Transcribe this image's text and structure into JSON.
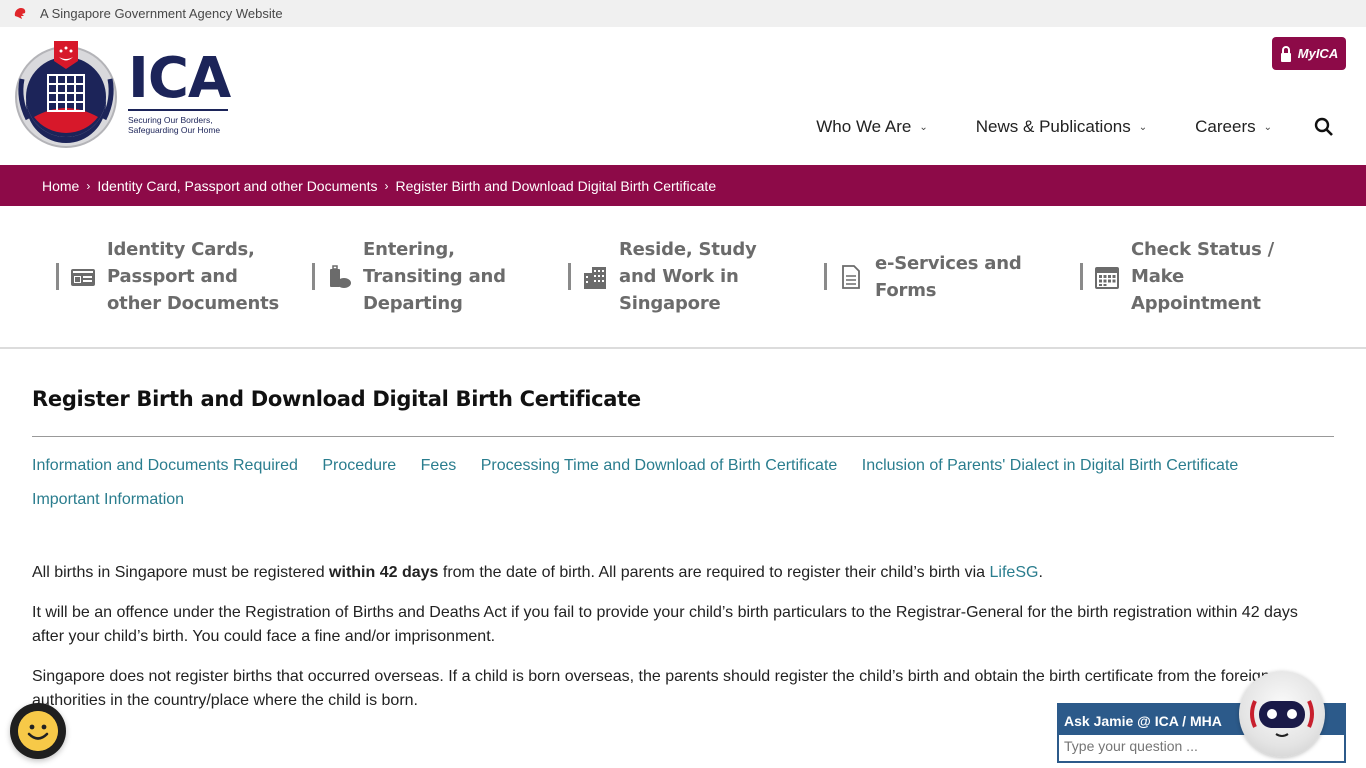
{
  "masthead": {
    "text": "A Singapore Government Agency Website",
    "icon": "lion-head-icon"
  },
  "header": {
    "logo_text": "ICA",
    "tagline_line1": "Securing Our Borders,",
    "tagline_line2": "Safeguarding Our Home",
    "myica_label": "MyICA",
    "nav": [
      {
        "label": "Who We Are"
      },
      {
        "label": "News & Publications"
      },
      {
        "label": "Careers"
      }
    ],
    "search_icon": "search-icon"
  },
  "breadcrumb": [
    {
      "label": "Home"
    },
    {
      "label": "Identity Card, Passport and other Documents"
    },
    {
      "label": "Register Birth and Download Digital Birth Certificate"
    }
  ],
  "quick_links": [
    {
      "label": "Identity Cards, Passport and other Documents",
      "icon": "id-card-icon"
    },
    {
      "label": "Entering, Transiting and Departing",
      "icon": "luggage-icon"
    },
    {
      "label": "Reside, Study and Work in Singapore",
      "icon": "building-icon"
    },
    {
      "label": "e-Services and Forms",
      "icon": "document-icon"
    },
    {
      "label": "Check Status / Make Appointment",
      "icon": "calendar-icon"
    }
  ],
  "page": {
    "title": "Register Birth and Download Digital Birth Certificate",
    "anchors": [
      "Information and Documents Required",
      "Procedure",
      "Fees",
      "Processing Time and Download of Birth Certificate",
      "Inclusion of Parents' Dialect in Digital Birth Certificate",
      "Important Information"
    ],
    "p1_before": "All births in Singapore must be registered ",
    "p1_bold": "within 42 days",
    "p1_after": " from the date of birth. All parents are required to register their child’s birth via ",
    "p1_link": "LifeSG",
    "p1_end": ".",
    "p2": "It will be an offence under the Registration of Births and Deaths Act if you fail to provide your child’s birth particulars to the Registrar-General for the birth registration within 42 days after your child’s birth. You could face a fine and/or imprisonment.",
    "p3": "Singapore does not register births that occurred overseas. If a child is born overseas, the parents should register the child’s birth and obtain the birth certificate from the foreign authorities in the country/place where the child is born."
  },
  "chat": {
    "title": "Ask Jamie @ ICA / MHA",
    "placeholder": "Type your question ..."
  },
  "colors": {
    "brand": "#8d0a48",
    "navy": "#1c2459",
    "link": "#2a7d8e",
    "chat": "#2c5a8a"
  }
}
